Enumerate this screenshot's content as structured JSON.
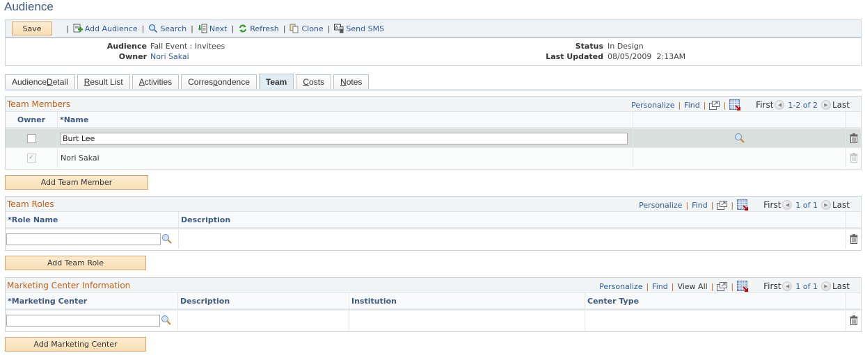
{
  "page": {
    "title": "Audience"
  },
  "toolbar": {
    "save_label": "Save",
    "items": [
      {
        "label": "Add Audience",
        "icon": "add-document-icon"
      },
      {
        "label": "Search",
        "icon": "search-icon"
      },
      {
        "label": "Next",
        "icon": "next-icon"
      },
      {
        "label": "Refresh",
        "icon": "refresh-icon"
      },
      {
        "label": "Clone",
        "icon": "clone-icon"
      },
      {
        "label": "Send SMS",
        "icon": "sms-icon"
      }
    ]
  },
  "header": {
    "audience_label": "Audience",
    "audience_value": "Fall Event : Invitees",
    "owner_label": "Owner",
    "owner_value": "Nori Sakai",
    "status_label": "Status",
    "status_value": "In Design",
    "last_updated_label": "Last Updated",
    "last_updated_value": "08/05/2009  2:13AM"
  },
  "tabs": [
    {
      "pre": "Audience ",
      "key": "D",
      "post": "etail",
      "active": false
    },
    {
      "pre": "",
      "key": "R",
      "post": "esult List",
      "active": false
    },
    {
      "pre": "",
      "key": "A",
      "post": "ctivities",
      "active": false
    },
    {
      "pre": "Corres",
      "key": "p",
      "post": "ondence",
      "active": false
    },
    {
      "pre": "Team",
      "key": "",
      "post": "",
      "active": true
    },
    {
      "pre": "",
      "key": "C",
      "post": "osts",
      "active": false
    },
    {
      "pre": "",
      "key": "N",
      "post": "otes",
      "active": false
    }
  ],
  "team_members": {
    "title": "Team Members",
    "nav": {
      "personalize": "Personalize",
      "find": "Find",
      "first": "First",
      "count": "1-2 of 2",
      "last": "Last"
    },
    "columns": {
      "owner": "Owner",
      "name": "*Name"
    },
    "rows": [
      {
        "owner_checked": false,
        "name": "Burt Lee",
        "editable": true
      },
      {
        "owner_checked": true,
        "name": "Nori Sakai",
        "editable": false
      }
    ],
    "add_label": "Add Team Member"
  },
  "team_roles": {
    "title": "Team Roles",
    "nav": {
      "personalize": "Personalize",
      "find": "Find",
      "first": "First",
      "count": "1 of 1",
      "last": "Last"
    },
    "columns": {
      "role_name": "*Role Name",
      "description": "Description"
    },
    "rows": [
      {
        "role_name": "",
        "description": ""
      }
    ],
    "add_label": "Add Team Role"
  },
  "marketing_center": {
    "title": "Marketing Center Information",
    "nav": {
      "personalize": "Personalize",
      "find": "Find",
      "view_all": "View All",
      "first": "First",
      "count": "1 of 1",
      "last": "Last"
    },
    "columns": {
      "center": "*Marketing Center",
      "description": "Description",
      "institution": "Institution",
      "center_type": "Center Type"
    },
    "rows": [
      {
        "center": "",
        "description": "",
        "institution": "",
        "center_type": ""
      }
    ],
    "add_label": "Add Marketing Center"
  }
}
